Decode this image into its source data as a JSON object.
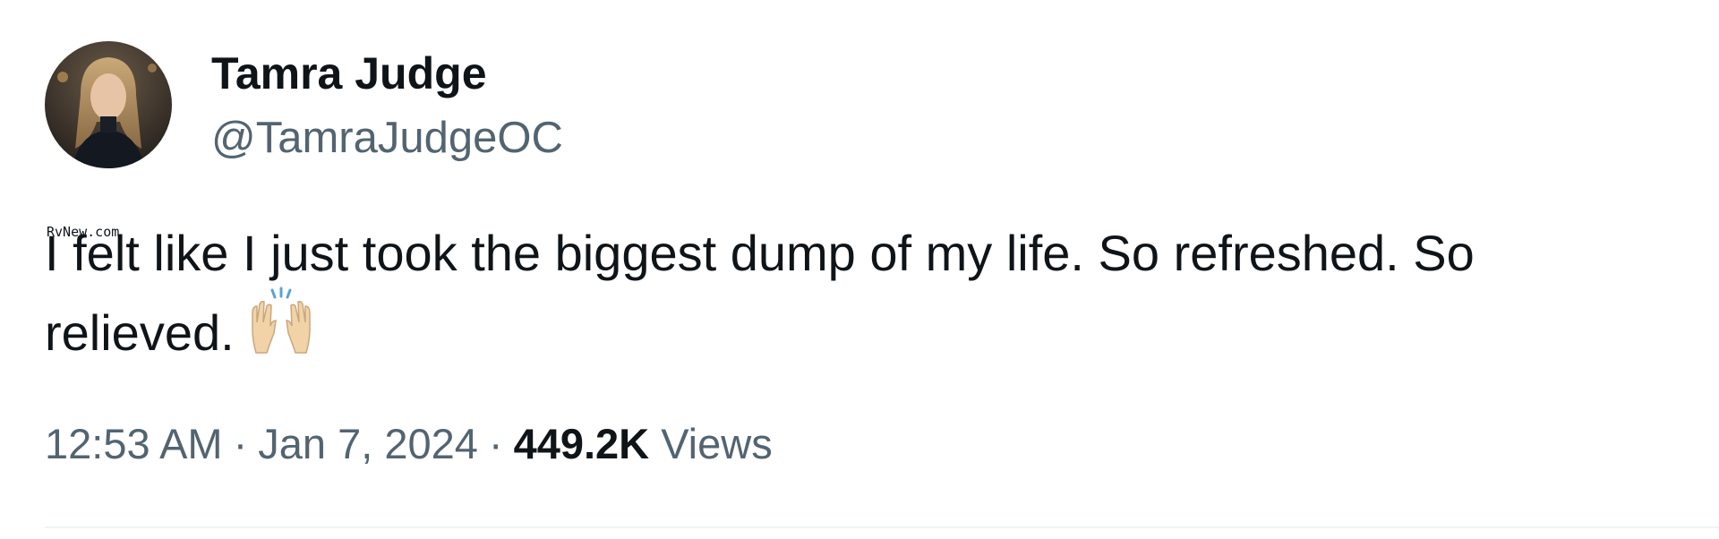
{
  "author": {
    "display_name": "Tamra Judge",
    "handle": "@TamraJudgeOC",
    "avatar_icon": "profile-photo"
  },
  "watermark": "RvNew.com",
  "tweet": {
    "text": "I felt like I just took the biggest dump of my life. So refreshed. So relieved.",
    "emoji_icon": "raising-hands-icon"
  },
  "meta": {
    "time": "12:53 AM",
    "separator": "·",
    "date": "Jan 7, 2024",
    "views_count": "449.2K",
    "views_label": "Views"
  },
  "colors": {
    "text_primary": "#0f1419",
    "text_secondary": "#536471",
    "divider": "#eff3f4",
    "emoji_skin": "#f2d3a8"
  }
}
